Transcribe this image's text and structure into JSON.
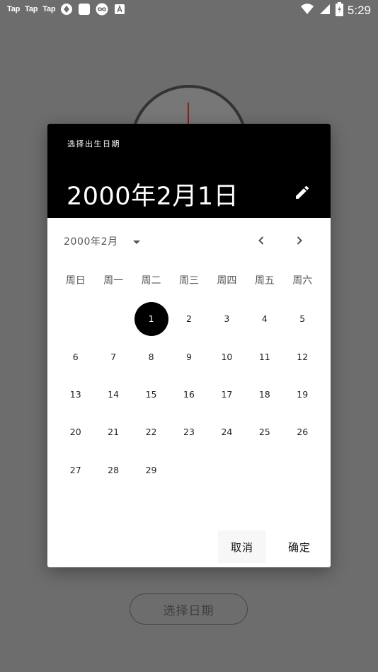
{
  "status_bar": {
    "tap_labels": [
      "Tap",
      "Tap",
      "Tap"
    ],
    "time": "5:29",
    "icons": [
      "taptap-icon",
      "taptap-icon",
      "taptap-icon",
      "app-icon",
      "white-square-icon",
      "infinity-icon",
      "font-a-icon",
      "wifi-icon",
      "signal-icon",
      "battery-icon"
    ]
  },
  "background": {
    "pick_date_button": "选择日期"
  },
  "dialog": {
    "subtitle": "选择出生日期",
    "selected_date": "2000年2月1日",
    "month_year": "2000年2月",
    "weekdays": [
      "周日",
      "周一",
      "周二",
      "周三",
      "周四",
      "周五",
      "周六"
    ],
    "weeks": [
      [
        "",
        "",
        "1",
        "2",
        "3",
        "4",
        "5"
      ],
      [
        "6",
        "7",
        "8",
        "9",
        "10",
        "11",
        "12"
      ],
      [
        "13",
        "14",
        "15",
        "16",
        "17",
        "18",
        "19"
      ],
      [
        "20",
        "21",
        "22",
        "23",
        "24",
        "25",
        "26"
      ],
      [
        "27",
        "28",
        "29",
        "",
        "",
        "",
        ""
      ]
    ],
    "selected_day": "1",
    "cancel_label": "取消",
    "ok_label": "确定"
  },
  "colors": {
    "overlay": "#6d6d6d",
    "header": "#000000",
    "selected_day_bg": "#000000"
  }
}
